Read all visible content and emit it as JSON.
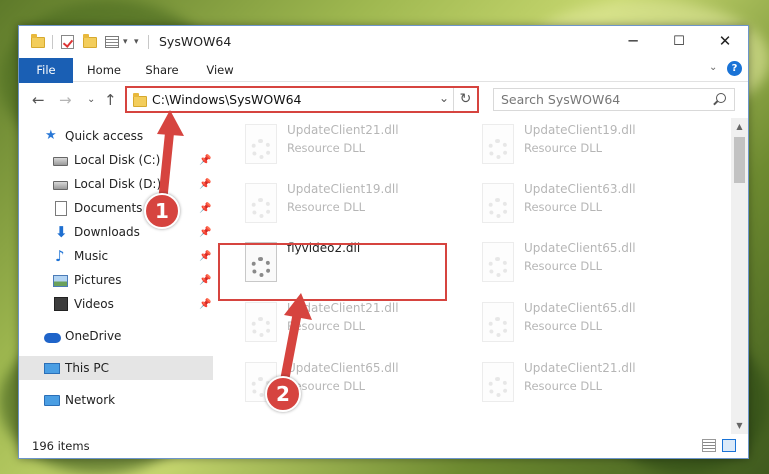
{
  "window": {
    "title": "SysWOW64",
    "controls": {
      "minimize": "─",
      "maximize": "☐",
      "close": "✕"
    }
  },
  "ribbon": {
    "tabs": [
      "File",
      "Home",
      "Share",
      "View"
    ],
    "expand": "⌄",
    "help": "?"
  },
  "nav": {
    "back": "←",
    "forward": "→",
    "recent": "⌄",
    "up": "↑",
    "address": "C:\\Windows\\SysWOW64",
    "address_dropdown": "⌄",
    "refresh": "↻",
    "search_placeholder": "Search SysWOW64"
  },
  "sidebar": {
    "items": [
      {
        "label": "Quick access",
        "icon": "star-icon"
      },
      {
        "label": "Local Disk (C:)",
        "icon": "drive-icon",
        "pinned": true
      },
      {
        "label": "Local Disk (D:)",
        "icon": "drive-icon",
        "pinned": true
      },
      {
        "label": "Documents",
        "icon": "documents-icon",
        "pinned": true
      },
      {
        "label": "Downloads",
        "icon": "downloads-icon",
        "pinned": true
      },
      {
        "label": "Music",
        "icon": "music-icon",
        "pinned": true
      },
      {
        "label": "Pictures",
        "icon": "pictures-icon",
        "pinned": true
      },
      {
        "label": "Videos",
        "icon": "videos-icon",
        "pinned": true
      },
      {
        "label": "OneDrive",
        "icon": "onedrive-icon"
      },
      {
        "label": "This PC",
        "icon": "pc-icon",
        "selected": true
      },
      {
        "label": "Network",
        "icon": "network-icon"
      }
    ],
    "pin_glyph": "📌"
  },
  "files": [
    {
      "name": "UpdateClient21.dll",
      "desc": "Resource DLL",
      "faded": true
    },
    {
      "name": "UpdateClient19.dll",
      "desc": "Resource DLL",
      "faded": true
    },
    {
      "name": "UpdateClient19.dll",
      "desc": "Resource DLL",
      "faded": true
    },
    {
      "name": "UpdateClient63.dll",
      "desc": "Resource DLL",
      "faded": true
    },
    {
      "name": "flyvideo2.dll",
      "desc": "",
      "faded": false
    },
    {
      "name": "UpdateClient65.dll",
      "desc": "Resource DLL",
      "faded": true
    },
    {
      "name": "UpdateClient21.dll",
      "desc": "Resource DLL",
      "faded": true
    },
    {
      "name": "UpdateClient65.dll",
      "desc": "Resource DLL",
      "faded": true
    },
    {
      "name": "UpdateClient65.dll",
      "desc": "Resource DLL",
      "faded": true
    },
    {
      "name": "UpdateClient21.dll",
      "desc": "Resource DLL",
      "faded": true
    }
  ],
  "status": {
    "item_count": "196 items"
  },
  "scroll": {
    "up": "▲",
    "down": "▼"
  },
  "annotations": {
    "step1": "1",
    "step2": "2",
    "color": "#d6443f"
  }
}
